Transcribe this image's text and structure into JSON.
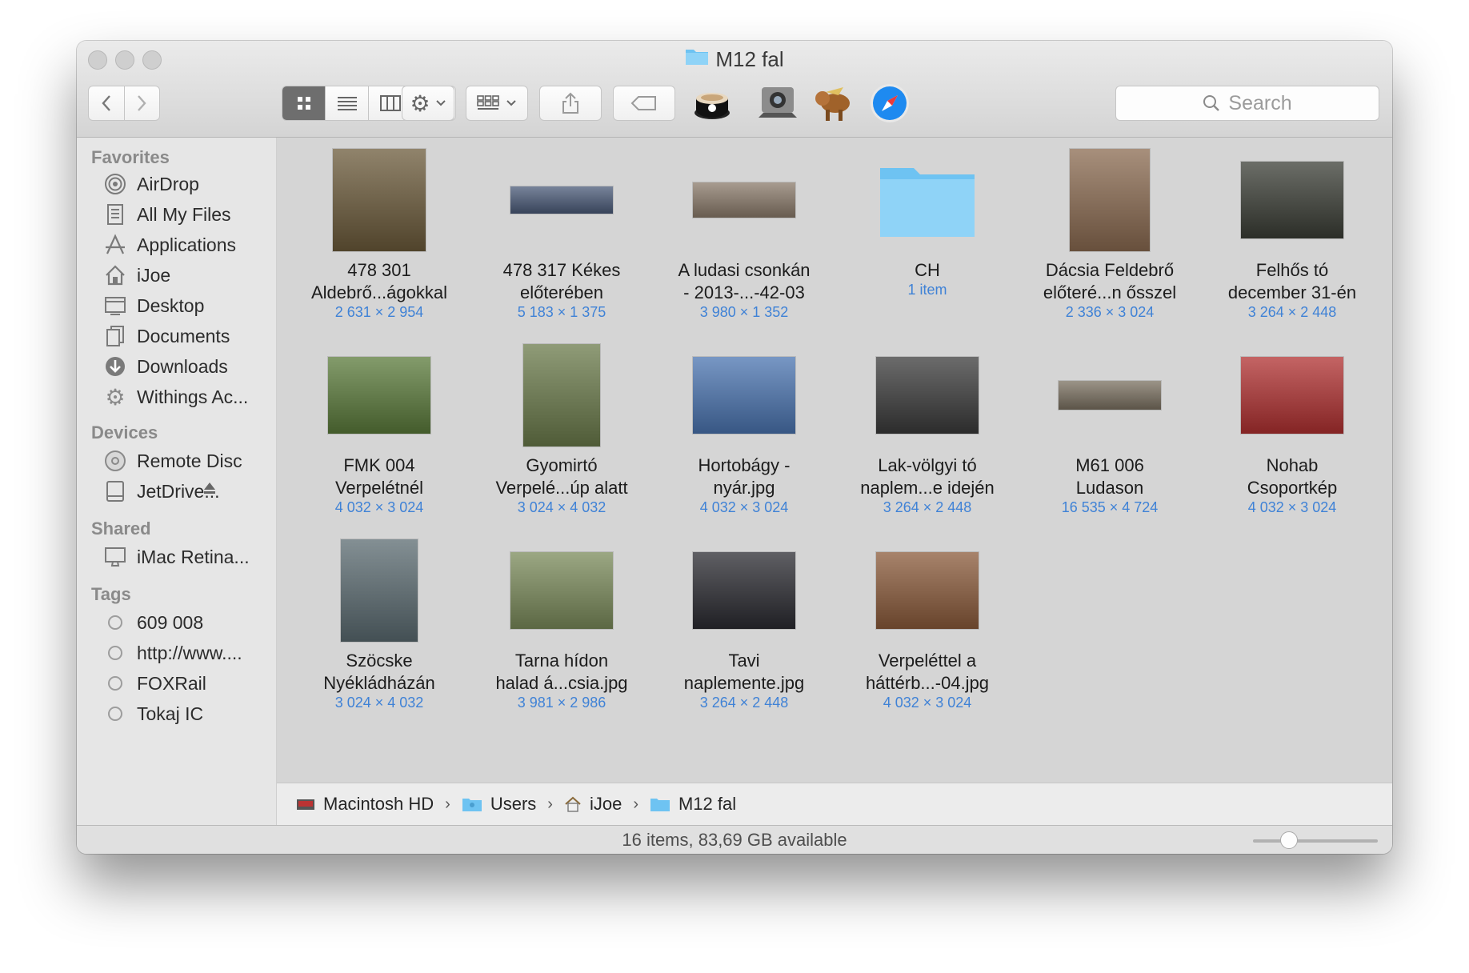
{
  "window": {
    "title": "M12 fal"
  },
  "search": {
    "placeholder": "Search"
  },
  "sidebar": {
    "favorites_header": "Favorites",
    "favorites": [
      {
        "label": "AirDrop",
        "icon": "airdrop-icon"
      },
      {
        "label": "All My Files",
        "icon": "all-files-icon"
      },
      {
        "label": "Applications",
        "icon": "applications-icon"
      },
      {
        "label": "iJoe",
        "icon": "home-icon"
      },
      {
        "label": "Desktop",
        "icon": "desktop-icon"
      },
      {
        "label": "Documents",
        "icon": "documents-icon"
      },
      {
        "label": "Downloads",
        "icon": "downloads-icon"
      },
      {
        "label": "Withings Ac...",
        "icon": "gear-icon"
      }
    ],
    "devices_header": "Devices",
    "devices": [
      {
        "label": "Remote Disc",
        "icon": "disc-icon"
      },
      {
        "label": "JetDrive...",
        "icon": "drive-icon"
      }
    ],
    "shared_header": "Shared",
    "shared": [
      {
        "label": "iMac Retina...",
        "icon": "imac-icon"
      }
    ],
    "tags_header": "Tags",
    "tags": [
      {
        "label": "609 008"
      },
      {
        "label": "http://www...."
      },
      {
        "label": "FOXRail"
      },
      {
        "label": "Tokaj IC"
      }
    ]
  },
  "files": [
    {
      "line1": "478 301",
      "line2": "Aldebrő...ágokkal",
      "meta": "2 631 × 2 954",
      "thumb_color": "#6b5a3a"
    },
    {
      "line1": "478 317 Kékes",
      "line2": "előterében",
      "meta": "5 183 × 1 375",
      "thumb_color": "#4a5a78"
    },
    {
      "line1": "A ludasi csonkán",
      "line2": "- 2013-...-42-03",
      "meta": "3 980 × 1 352",
      "thumb_color": "#8a7a6a"
    },
    {
      "line1": "CH",
      "line2": "",
      "meta": "1 item",
      "thumb_color": "#7fcaf3"
    },
    {
      "line1": "Dácsia Feldebrő",
      "line2": "előteré...n ősszel",
      "meta": "2 336 × 3 024",
      "thumb_color": "#8a6a50"
    },
    {
      "line1": "Felhős tó",
      "line2": "december 31-én",
      "meta": "3 264 × 2 448",
      "thumb_color": "#3a3d35"
    },
    {
      "line1": "FMK 004",
      "line2": "Verpelétnél",
      "meta": "4 032 × 3 024",
      "thumb_color": "#5a7a3a"
    },
    {
      "line1": "Gyomirtó",
      "line2": "Verpelé...úp alatt",
      "meta": "3 024 × 4 032",
      "thumb_color": "#6a7a4a"
    },
    {
      "line1": "Hortobágy -",
      "line2": "nyár.jpg",
      "meta": "4 032 × 3 024",
      "thumb_color": "#4a74b0"
    },
    {
      "line1": "Lak-völgyi tó",
      "line2": "naplem...e idején",
      "meta": "3 264 × 2 448",
      "thumb_color": "#3a3a3a"
    },
    {
      "line1": "M61 006",
      "line2": "Ludason",
      "meta": "16 535 × 4 724",
      "thumb_color": "#7a7060"
    },
    {
      "line1": "Nohab",
      "line2": "Csoportkép",
      "meta": "4 032 × 3 024",
      "thumb_color": "#b03030"
    },
    {
      "line1": "Szöcske",
      "line2": "Nyékládházán",
      "meta": "3 024 × 4 032",
      "thumb_color": "#5a6a70"
    },
    {
      "line1": "Tarna hídon",
      "line2": "halad á...csia.jpg",
      "meta": "3 981 × 2 986",
      "thumb_color": "#7a8a5a"
    },
    {
      "line1": "Tavi",
      "line2": "naplemente.jpg",
      "meta": "3 264 × 2 448",
      "thumb_color": "#2a2a30"
    },
    {
      "line1": "Verpeléttel a",
      "line2": "háttérb...-04.jpg",
      "meta": "4 032 × 3 024",
      "thumb_color": "#8a5a3a"
    }
  ],
  "pathbar": [
    {
      "label": "Macintosh HD",
      "icon": "hard-drive-icon"
    },
    {
      "label": "Users",
      "icon": "users-folder-icon"
    },
    {
      "label": "iJoe",
      "icon": "home-icon"
    },
    {
      "label": "M12 fal",
      "icon": "folder-icon"
    }
  ],
  "status": {
    "text": "16 items, 83,69 GB available",
    "icon_size_level": 0.25
  }
}
